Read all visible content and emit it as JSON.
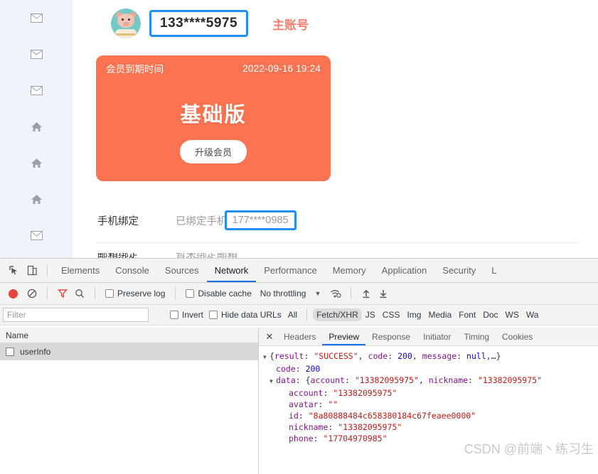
{
  "page": {
    "sidebar": {
      "icons": [
        {
          "name": "mail-icon",
          "glyph": "envelope"
        },
        {
          "name": "mail-icon",
          "glyph": "envelope"
        },
        {
          "name": "mail-icon",
          "glyph": "envelope"
        },
        {
          "name": "home-icon",
          "glyph": "home"
        },
        {
          "name": "home-icon",
          "glyph": "home"
        },
        {
          "name": "home-icon",
          "glyph": "home"
        },
        {
          "name": "mail-icon",
          "glyph": "envelope"
        }
      ]
    },
    "account": {
      "phone_masked": "133****5975",
      "role_label": "主账号"
    },
    "member_card": {
      "expire_label": "会员到期时间",
      "expire_date": "2022-09-16 19:24",
      "level": "基础版",
      "upgrade_label": "升级会员",
      "bg_color": "#fb7350"
    },
    "bind_row": {
      "label": "手机绑定",
      "prefix": "已绑定手机",
      "phone_masked": "177****0985"
    },
    "highlight_color": "#1e90f5"
  },
  "devtools": {
    "tabs": [
      {
        "label": "Elements",
        "active": false
      },
      {
        "label": "Console",
        "active": false
      },
      {
        "label": "Sources",
        "active": false
      },
      {
        "label": "Network",
        "active": true
      },
      {
        "label": "Performance",
        "active": false
      },
      {
        "label": "Memory",
        "active": false
      },
      {
        "label": "Application",
        "active": false
      },
      {
        "label": "Security",
        "active": false
      },
      {
        "label": "L",
        "active": false
      }
    ],
    "toolbar": {
      "preserve_log_label": "Preserve log",
      "disable_cache_label": "Disable cache",
      "throttling_value": "No throttling",
      "caret": "▼"
    },
    "filterbar": {
      "filter_placeholder": "Filter",
      "invert_label": "Invert",
      "hide_data_urls_label": "Hide data URLs",
      "types": [
        {
          "label": "All",
          "selected": false
        },
        {
          "label": "Fetch/XHR",
          "selected": true
        },
        {
          "label": "JS",
          "selected": false
        },
        {
          "label": "CSS",
          "selected": false
        },
        {
          "label": "Img",
          "selected": false
        },
        {
          "label": "Media",
          "selected": false
        },
        {
          "label": "Font",
          "selected": false
        },
        {
          "label": "Doc",
          "selected": false
        },
        {
          "label": "WS",
          "selected": false
        },
        {
          "label": "Wa",
          "selected": false
        }
      ]
    },
    "requests": {
      "column_header": "Name",
      "rows": [
        {
          "name": "userInfo",
          "selected": true
        }
      ]
    },
    "detail_tabs": [
      {
        "label": "Headers",
        "active": false
      },
      {
        "label": "Preview",
        "active": true
      },
      {
        "label": "Response",
        "active": false
      },
      {
        "label": "Initiator",
        "active": false
      },
      {
        "label": "Timing",
        "active": false
      },
      {
        "label": "Cookies",
        "active": false
      }
    ],
    "preview": {
      "line0_pre": "{",
      "line0_k1": "result",
      "line0_v1": "\"SUCCESS\"",
      "line0_k2": "code",
      "line0_v2": "200",
      "line0_k3": "message",
      "line0_v3": "null",
      "line0_post": ",…}",
      "line1_k": "code",
      "line1_v": "200",
      "line2_k": "data",
      "line2_pre": "{",
      "line2_k1": "account",
      "line2_v1": "\"13382095975\"",
      "line2_k2": "nickname",
      "line2_v2": "\"13382095975\"",
      "line3_k": "account",
      "line3_v": "\"13382095975\"",
      "line4_k": "avatar",
      "line4_v": "\"\"",
      "line5_k": "id",
      "line5_v": "\"8a80888484c658380184c67feaee0000\"",
      "line6_k": "nickname",
      "line6_v": "\"13382095975\"",
      "line7_k": "phone",
      "line7_v": "\"17704970985\""
    },
    "watermark": "CSDN @前端丶练习生"
  }
}
